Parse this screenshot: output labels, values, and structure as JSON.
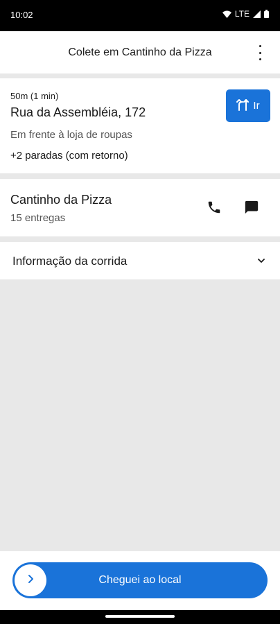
{
  "status_bar": {
    "time": "10:02",
    "network": "LTE"
  },
  "header": {
    "title": "Colete em Cantinho da Pizza"
  },
  "pickup": {
    "eta": "50m (1 min)",
    "address": "Rua da Assembléia, 172",
    "reference": "Em frente à loja de roupas",
    "stops": "+2 paradas (com retorno)",
    "go_label": "Ir"
  },
  "store": {
    "name": "Cantinho da Pizza",
    "deliveries": "15 entregas"
  },
  "ride_info": {
    "label": "Informação da corrida"
  },
  "arrive": {
    "label": "Cheguei ao local"
  },
  "icons": [
    "wifi-icon",
    "signal-icon",
    "battery-icon",
    "more-icon",
    "route-icon",
    "phone-icon",
    "chat-icon",
    "chevron-down-icon",
    "chevron-right-icon"
  ],
  "colors": {
    "accent": "#1a73d9",
    "background": "#e8e8e8"
  }
}
